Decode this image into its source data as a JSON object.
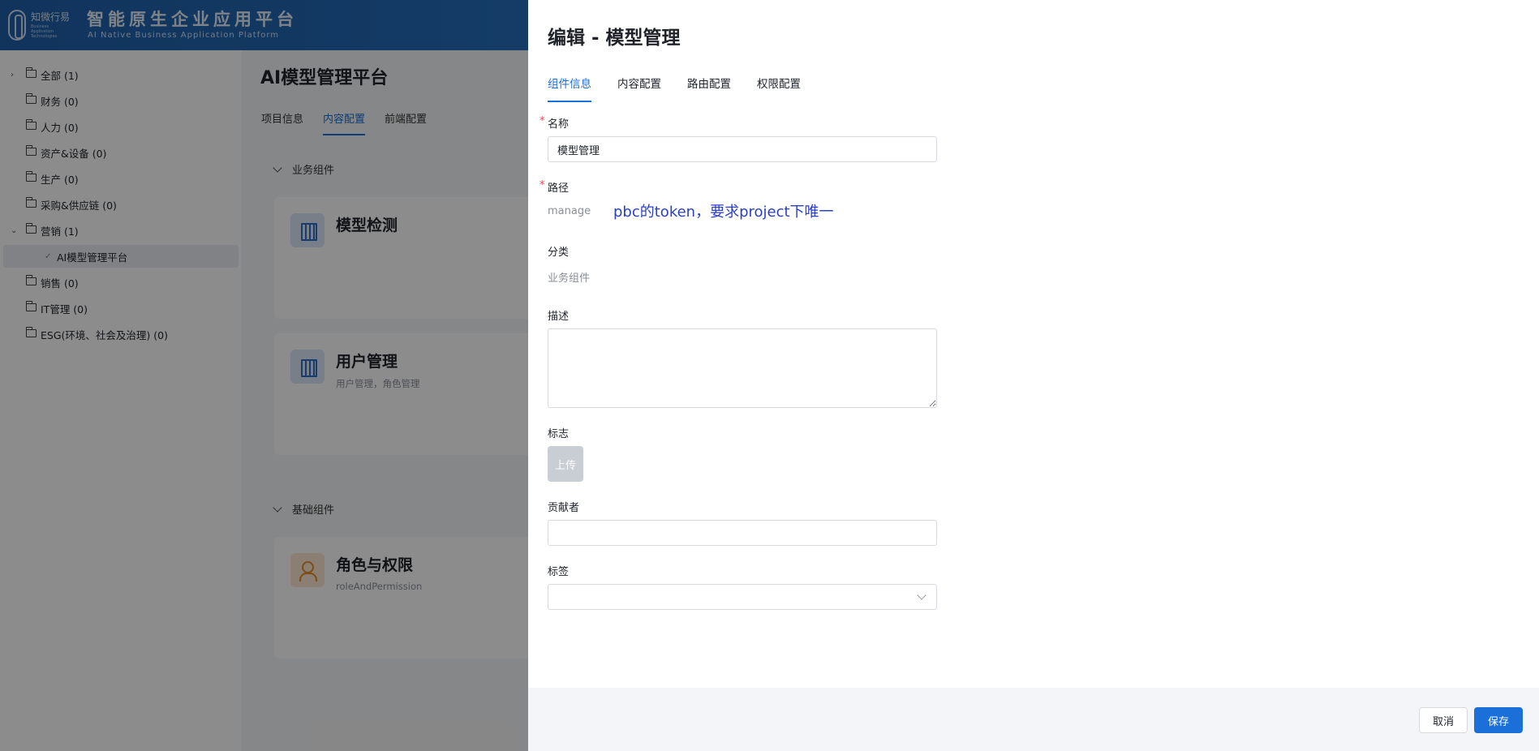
{
  "header": {
    "brand": "知微行易",
    "brand_sub": "Business Application Technologies",
    "title": "智能原生企业应用平台",
    "subtitle": "AI Native Business Application Platform"
  },
  "sidebar": {
    "items": [
      {
        "label": "全部 (1)",
        "expand": "›"
      },
      {
        "label": "财务 (0)"
      },
      {
        "label": "人力 (0)"
      },
      {
        "label": "资产&设备 (0)"
      },
      {
        "label": "生产 (0)"
      },
      {
        "label": "采购&供应链 (0)"
      },
      {
        "label": "营销 (1)",
        "expand": "⌄"
      },
      {
        "label": "AI模型管理平台",
        "selected": true,
        "leaf_icon": "✓"
      },
      {
        "label": "销售 (0)"
      },
      {
        "label": "IT管理 (0)"
      },
      {
        "label": "ESG(环境、社会及治理) (0)"
      }
    ]
  },
  "main": {
    "title": "AI模型管理平台",
    "tabs": [
      "项目信息",
      "内容配置",
      "前端配置"
    ],
    "active_tab": "内容配置",
    "sections": {
      "business": "业务组件",
      "basic": "基础组件"
    },
    "cards": [
      {
        "title": "模型检测",
        "desc": "",
        "icon": "building-icon"
      },
      {
        "title": "用户管理",
        "desc": "用户管理，角色管理",
        "icon": "building-icon"
      },
      {
        "title": "角色与权限",
        "desc": "roleAndPermission",
        "icon": "user-gear-icon"
      }
    ]
  },
  "drawer": {
    "title": "编辑 - 模型管理",
    "tabs": [
      "组件信息",
      "内容配置",
      "路由配置",
      "权限配置"
    ],
    "active_tab": "组件信息",
    "form": {
      "name_label": "名称",
      "name_value": "模型管理",
      "path_label": "路径",
      "path_value": "manage",
      "path_annotation": "pbc的token，要求project下唯一",
      "category_label": "分类",
      "category_value": "业务组件",
      "desc_label": "描述",
      "desc_value": "",
      "logo_label": "标志",
      "upload_label": "上传",
      "contributor_label": "贡献者",
      "contributor_value": "",
      "tags_label": "标签",
      "required_mark": "*"
    },
    "footer": {
      "cancel_label": "取消",
      "save_label": "保存"
    }
  },
  "colors": {
    "primary": "#1a6fd8",
    "required": "#e34d59",
    "annotation": "#2a3fc8",
    "header_start": "#1e5fa8",
    "header_end": "#3a8ad8"
  }
}
